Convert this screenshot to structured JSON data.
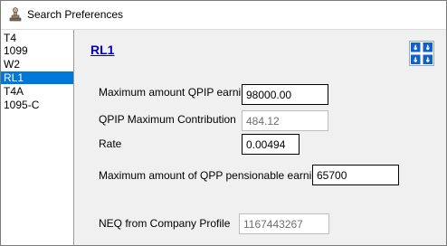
{
  "window": {
    "title": "Search Preferences"
  },
  "forms_list": {
    "items": [
      "T4",
      "1099",
      "W2",
      "RL1",
      "T4A",
      "1095-C"
    ],
    "selected": "RL1"
  },
  "section": {
    "title": "RL1",
    "flag_icon": "quebec-flag-icon"
  },
  "fields": {
    "max_qpip": {
      "label": "Maximum amount QPIP earni",
      "value": "98000.00"
    },
    "qpip_max_contribution": {
      "label": "QPIP Maximum Contribution",
      "value": "484.12"
    },
    "rate": {
      "label": "Rate",
      "value": "0.00494"
    },
    "max_qpp": {
      "label": "Maximum amount of QPP pensionable earni",
      "value": "65700"
    },
    "neq": {
      "label": "NEQ from Company Profile",
      "value": "1167443267"
    }
  },
  "colors": {
    "selection": "#0078d7",
    "link": "#0000cc",
    "flag_blue": "#1160c8",
    "content_bg": "#f0f0f0"
  }
}
